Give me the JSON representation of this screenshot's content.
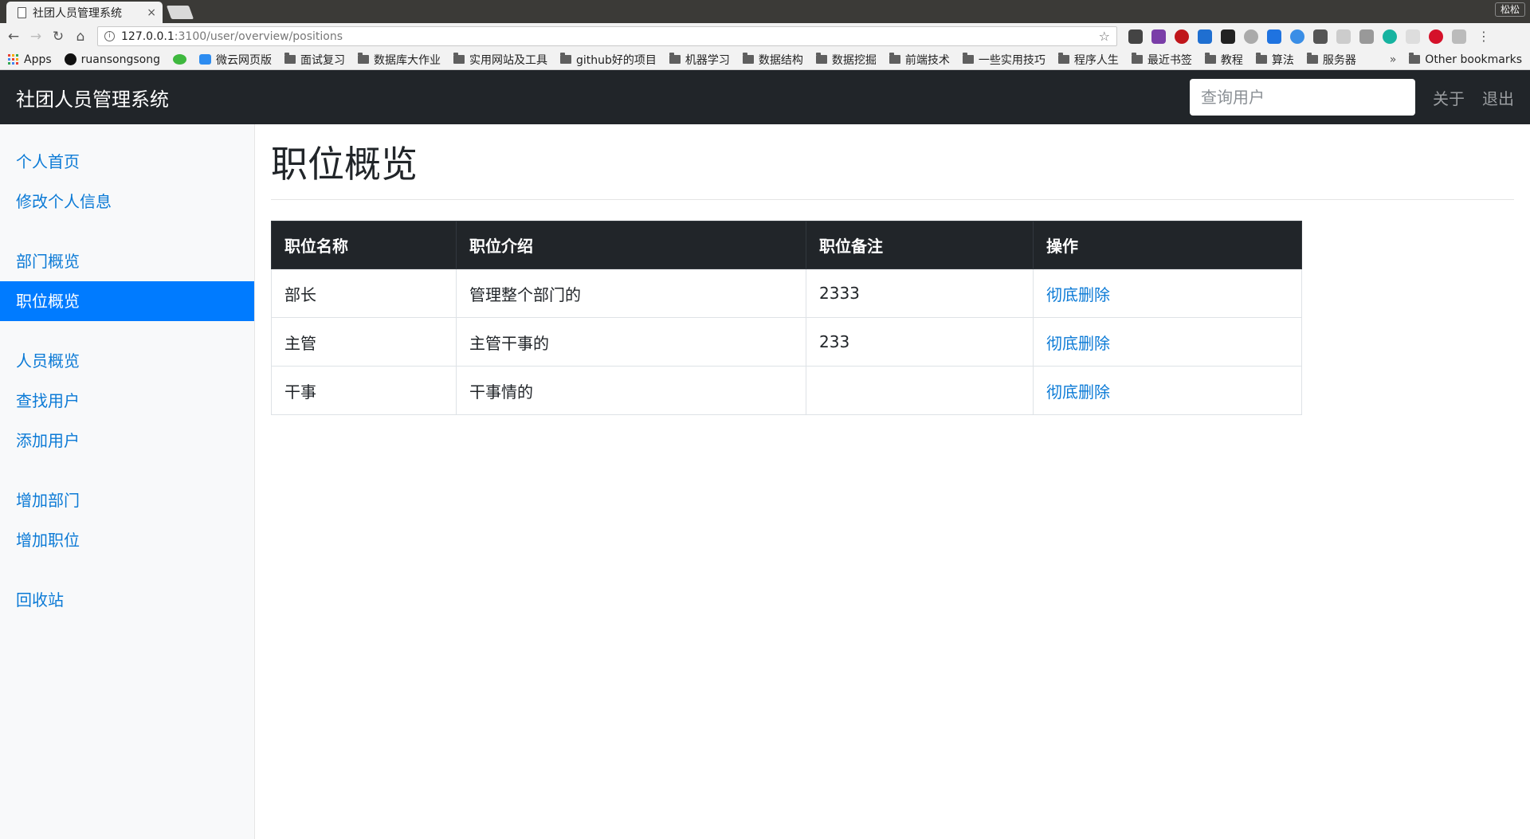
{
  "browser": {
    "tab_title": "社团人员管理系统",
    "tab_close": "×",
    "profile_name": "松松",
    "url_host": "127.0.0.1",
    "url_path": ":3100/user/overview/positions",
    "bookmarks": [
      {
        "label": "Apps",
        "icon": "apps-icon"
      },
      {
        "label": "ruansongsong",
        "icon": "github-icon"
      },
      {
        "label": "",
        "icon": "wechat-icon"
      },
      {
        "label": "微云网页版",
        "icon": "weiyun-icon"
      },
      {
        "label": "面试复习",
        "icon": "folder-icon"
      },
      {
        "label": "数据库大作业",
        "icon": "folder-icon"
      },
      {
        "label": "实用网站及工具",
        "icon": "folder-icon"
      },
      {
        "label": "github好的项目",
        "icon": "folder-icon"
      },
      {
        "label": "机器学习",
        "icon": "folder-icon"
      },
      {
        "label": "数据结构",
        "icon": "folder-icon"
      },
      {
        "label": "数据挖掘",
        "icon": "folder-icon"
      },
      {
        "label": "前端技术",
        "icon": "folder-icon"
      },
      {
        "label": "一些实用技巧",
        "icon": "folder-icon"
      },
      {
        "label": "程序人生",
        "icon": "folder-icon"
      },
      {
        "label": "最近书签",
        "icon": "folder-icon"
      },
      {
        "label": "教程",
        "icon": "folder-icon"
      },
      {
        "label": "算法",
        "icon": "folder-icon"
      },
      {
        "label": "服务器",
        "icon": "folder-icon"
      }
    ],
    "bookmarks_more": "»",
    "other_bookmarks": "Other bookmarks"
  },
  "navbar": {
    "brand": "社团人员管理系统",
    "search_placeholder": "查询用户",
    "about": "关于",
    "logout": "退出"
  },
  "sidebar": {
    "groups": [
      [
        "个人首页",
        "修改个人信息"
      ],
      [
        "部门概览",
        "职位概览"
      ],
      [
        "人员概览",
        "查找用户",
        "添加用户"
      ],
      [
        "增加部门",
        "增加职位"
      ],
      [
        "回收站"
      ]
    ],
    "active": "职位概览"
  },
  "main": {
    "title": "职位概览",
    "table": {
      "headers": [
        "职位名称",
        "职位介绍",
        "职位备注",
        "操作"
      ],
      "rows": [
        {
          "name": "部长",
          "intro": "管理整个部门的",
          "note": "2333",
          "action": "彻底删除"
        },
        {
          "name": "主管",
          "intro": "主管干事的",
          "note": "233",
          "action": "彻底删除"
        },
        {
          "name": "干事",
          "intro": "干事情的",
          "note": "",
          "action": "彻底删除"
        }
      ]
    }
  },
  "colors": {
    "navbar_bg": "#212529",
    "link": "#0b7ad6",
    "active_bg": "#007bff"
  }
}
